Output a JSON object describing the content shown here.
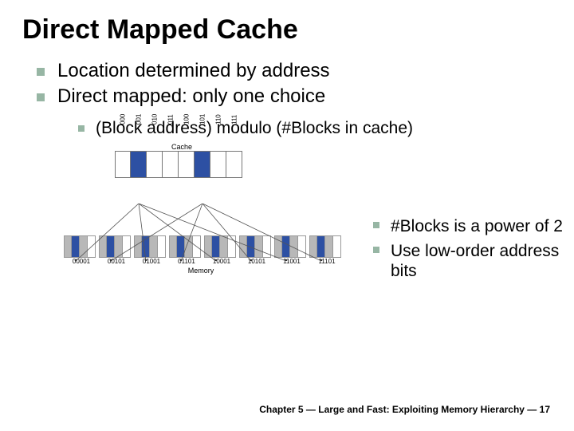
{
  "title": "Direct Mapped Cache",
  "bullets": {
    "b1": "Location determined by address",
    "b2": "Direct mapped: only one choice",
    "sub1": "(Block address) modulo (#Blocks in cache)"
  },
  "right": {
    "r1": "#Blocks is a power of 2",
    "r2": "Use low-order address bits"
  },
  "figure": {
    "cache_caption": "Cache",
    "cache_labels": [
      "000",
      "001",
      "010",
      "011",
      "100",
      "101",
      "110",
      "111"
    ],
    "cache_highlight": [
      1,
      5
    ],
    "memory_caption": "Memory",
    "memory_labels": [
      "00001",
      "00101",
      "01001",
      "01101",
      "10001",
      "10101",
      "11001",
      "11101"
    ],
    "memory_group_highlight_col": 1,
    "memory_group_grey_cols": [
      0,
      2
    ]
  },
  "footer": "Chapter 5 — Large and Fast: Exploiting Memory Hierarchy — 17"
}
